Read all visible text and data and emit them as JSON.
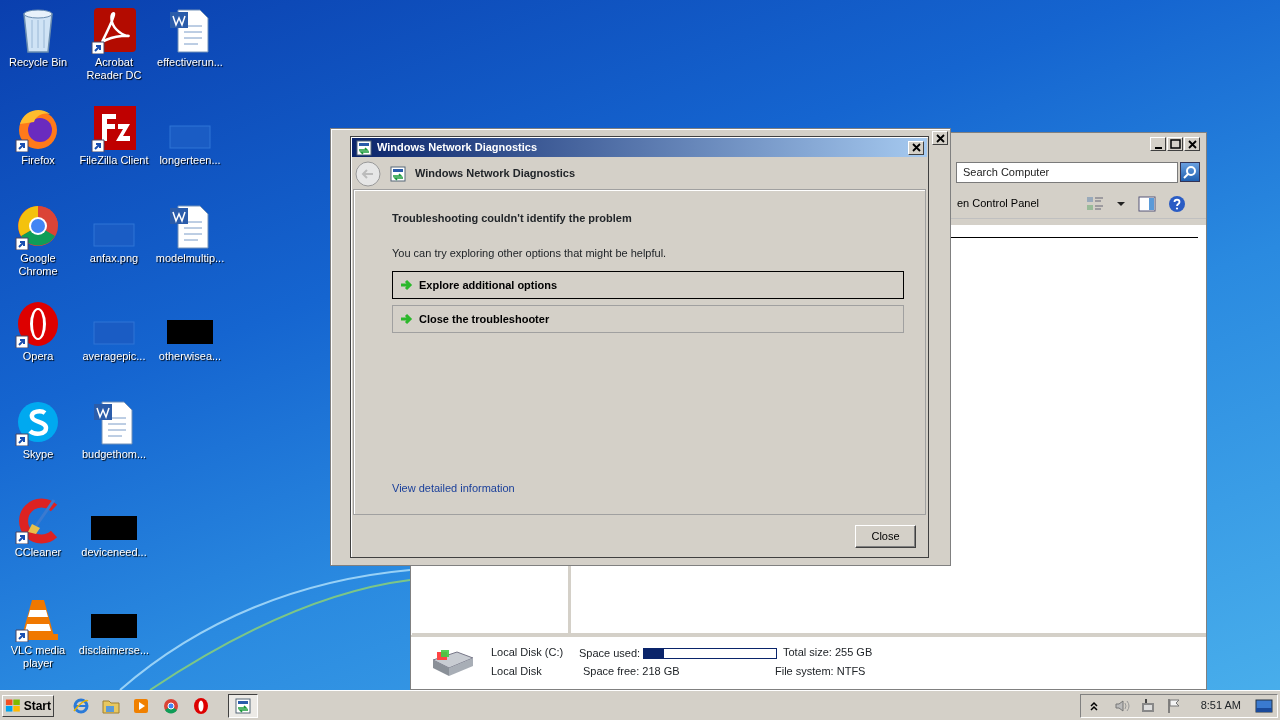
{
  "desktop_icons": [
    {
      "label": "Recycle Bin",
      "kind": "recycle",
      "shortcut": false
    },
    {
      "label": "Firefox",
      "kind": "firefox",
      "shortcut": true
    },
    {
      "label": "Google Chrome",
      "kind": "chrome",
      "shortcut": true
    },
    {
      "label": "Opera",
      "kind": "opera",
      "shortcut": true
    },
    {
      "label": "Skype",
      "kind": "skype",
      "shortcut": true
    },
    {
      "label": "CCleaner",
      "kind": "ccleaner",
      "shortcut": true
    },
    {
      "label": "VLC media player",
      "kind": "vlc",
      "shortcut": true
    },
    {
      "label": "Acrobat Reader DC",
      "kind": "acrobat",
      "shortcut": true
    },
    {
      "label": "FileZilla Client",
      "kind": "filezilla",
      "shortcut": true
    },
    {
      "label": "anfax.png",
      "kind": "blank",
      "shortcut": false
    },
    {
      "label": "averagepic...",
      "kind": "blank",
      "shortcut": false
    },
    {
      "label": "budgethom...",
      "kind": "word",
      "shortcut": false
    },
    {
      "label": "deviceneed...",
      "kind": "black",
      "shortcut": false
    },
    {
      "label": "disclaimerse...",
      "kind": "black",
      "shortcut": false
    },
    {
      "label": "effectiverun...",
      "kind": "word",
      "shortcut": false
    },
    {
      "label": "longerteen...",
      "kind": "blank",
      "shortcut": false
    },
    {
      "label": "modelmultip...",
      "kind": "word",
      "shortcut": false
    },
    {
      "label": "otherwisea...",
      "kind": "black",
      "shortcut": false
    }
  ],
  "explorer": {
    "search": {
      "placeholder": "Search Computer"
    },
    "toolbar_text": "en Control Panel",
    "details": {
      "name": "Local Disk (C:)",
      "type": "Local Disk",
      "used_label": "Space used:",
      "level": 0.15,
      "free": "Space free: 218 GB",
      "total": "Total size: 255 GB",
      "file_system": "File system: NTFS"
    }
  },
  "dialog": {
    "title": "Windows Network Diagnostics",
    "header": "Windows Network Diagnostics",
    "heading": "Troubleshooting couldn't identify the problem",
    "text": "You can try exploring other options that might be helpful.",
    "options": [
      {
        "label": "Explore additional options",
        "focused": true
      },
      {
        "label": "Close the troubleshooter",
        "focused": false
      }
    ],
    "link": "View detailed information",
    "button": "Close"
  },
  "taskbar": {
    "start": "Start",
    "quick_launch": [
      {
        "kind": "ie"
      },
      {
        "kind": "explorer"
      },
      {
        "kind": "media"
      },
      {
        "kind": "chrome"
      },
      {
        "kind": "opera"
      }
    ],
    "tasks": [
      {
        "kind": "diagnostics",
        "active": true
      }
    ],
    "tray": [
      {
        "kind": "chevron"
      },
      {
        "kind": "speaker"
      },
      {
        "kind": "network"
      },
      {
        "kind": "flag"
      }
    ],
    "clock": "8:51 AM"
  }
}
